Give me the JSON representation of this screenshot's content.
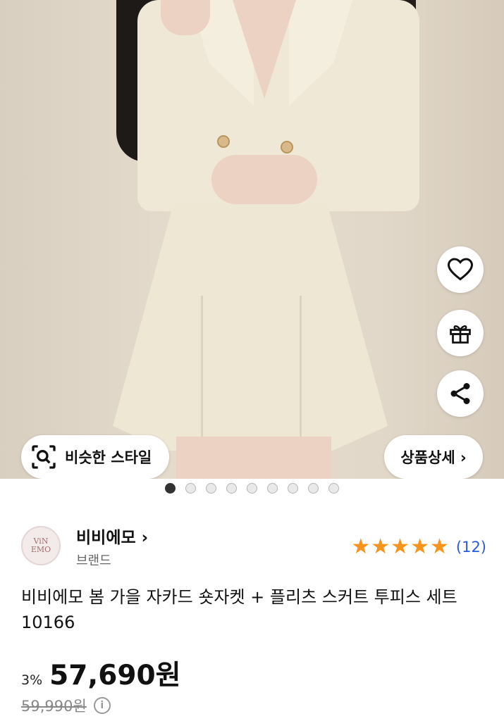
{
  "hero": {
    "similar_style_label": "비슷한 스타일",
    "detail_label": "상품상세 ›",
    "side_actions": [
      "heart-icon",
      "gift-icon",
      "share-icon"
    ]
  },
  "carousel": {
    "total": 9,
    "active": 1
  },
  "brand": {
    "name": "비비에모 ›",
    "sub": "브랜드",
    "logo_line1": "ViN",
    "logo_line2": "EMO"
  },
  "rating": {
    "stars": 5,
    "review_count": "(12)",
    "star_color": "#f7941d"
  },
  "product": {
    "title": "비비에모 봄 가을 자카드 숏자켓 + 플리츠 스커트 투피스 세트 10166",
    "discount": "3%",
    "price": "57,690원",
    "original_price": "59,990원"
  }
}
